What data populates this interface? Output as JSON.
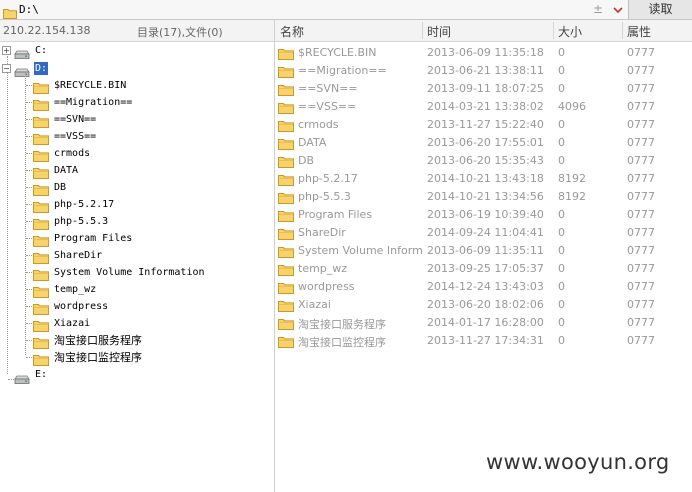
{
  "pathbar": {
    "path": "D:\\",
    "up_glyph": "±",
    "dropdown_icon": "chevron-down-icon",
    "read_label": "读取",
    "accent": "#c0392b"
  },
  "left": {
    "ip": "210.22.154.138",
    "summary": "目录(17),文件(0)"
  },
  "tree": {
    "drives": [
      "C:",
      "D:",
      "E:"
    ],
    "folders": [
      "$RECYCLE.BIN",
      "==Migration==",
      "==SVN==",
      "==VSS==",
      "crmods",
      "DATA",
      "DB",
      "php-5.2.17",
      "php-5.5.3",
      "Program Files",
      "ShareDir",
      "System Volume Information",
      "temp_wz",
      "wordpress",
      "Xiazai",
      "淘宝接口服务程序",
      "淘宝接口监控程序"
    ]
  },
  "columns": [
    "名称",
    "时间",
    "大小",
    "属性"
  ],
  "files": [
    {
      "name": "$RECYCLE.BIN",
      "time": "2013-06-09 11:35:18",
      "size": "0",
      "attr": "0777"
    },
    {
      "name": "==Migration==",
      "time": "2013-06-21 13:38:11",
      "size": "0",
      "attr": "0777"
    },
    {
      "name": "==SVN==",
      "time": "2013-09-11 18:07:25",
      "size": "0",
      "attr": "0777"
    },
    {
      "name": "==VSS==",
      "time": "2014-03-21 13:38:02",
      "size": "4096",
      "attr": "0777"
    },
    {
      "name": "crmods",
      "time": "2013-11-27 15:22:40",
      "size": "0",
      "attr": "0777"
    },
    {
      "name": "DATA",
      "time": "2013-06-20 17:55:01",
      "size": "0",
      "attr": "0777"
    },
    {
      "name": "DB",
      "time": "2013-06-20 15:35:43",
      "size": "0",
      "attr": "0777"
    },
    {
      "name": "php-5.2.17",
      "time": "2014-10-21 13:43:18",
      "size": "8192",
      "attr": "0777"
    },
    {
      "name": "php-5.5.3",
      "time": "2014-10-21 13:34:56",
      "size": "8192",
      "attr": "0777"
    },
    {
      "name": "Program Files",
      "time": "2013-06-19 10:39:40",
      "size": "0",
      "attr": "0777"
    },
    {
      "name": "ShareDir",
      "time": "2014-09-24 11:04:41",
      "size": "0",
      "attr": "0777"
    },
    {
      "name": "System Volume Informati...",
      "time": "2013-06-09 11:35:11",
      "size": "0",
      "attr": "0777"
    },
    {
      "name": "temp_wz",
      "time": "2013-09-25 17:05:37",
      "size": "0",
      "attr": "0777"
    },
    {
      "name": "wordpress",
      "time": "2014-12-24 13:43:03",
      "size": "0",
      "attr": "0777"
    },
    {
      "name": "Xiazai",
      "time": "2013-06-20 18:02:06",
      "size": "0",
      "attr": "0777"
    },
    {
      "name": "淘宝接口服务程序",
      "time": "2014-01-17 16:28:00",
      "size": "0",
      "attr": "0777"
    },
    {
      "name": "淘宝接口监控程序",
      "time": "2013-11-27 17:34:31",
      "size": "0",
      "attr": "0777"
    }
  ],
  "watermark": "www.wooyun.org",
  "colors": {
    "folder_fill": "#f6d36b",
    "folder_stroke": "#c99a26",
    "selection": "#316ac5"
  }
}
